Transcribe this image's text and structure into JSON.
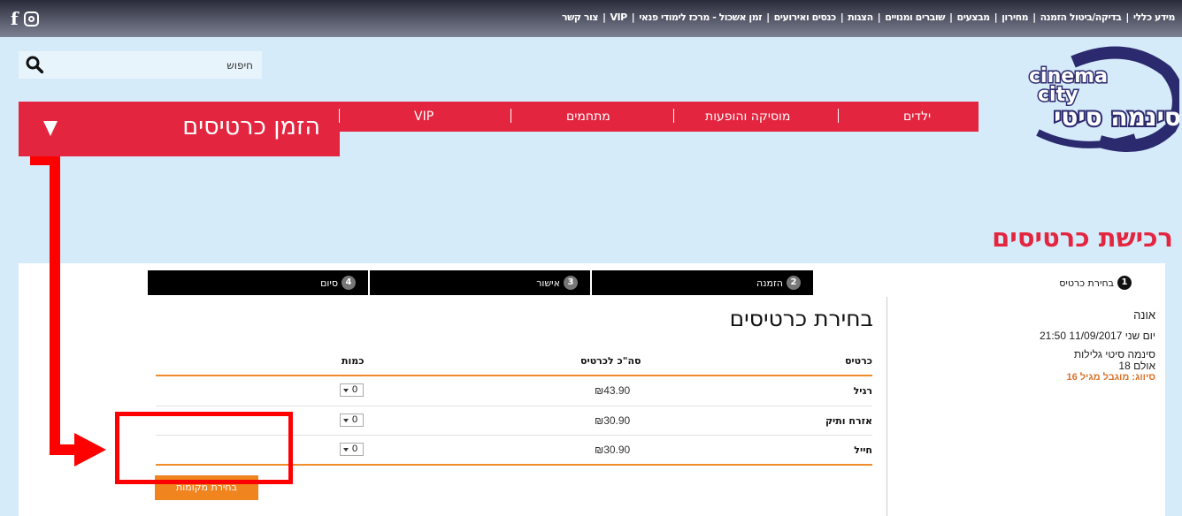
{
  "top_nav": {
    "links": [
      "מידע כללי",
      "בדיקה/ביטול הזמנה",
      "מחירון",
      "מבצעים",
      "שוברים ומנויים",
      "הצגות",
      "כנסים ואירועים",
      "זמן אשכול - מרכז לימודי פנאי",
      "VIP",
      "צור קשר"
    ]
  },
  "search": {
    "placeholder": "חיפוש"
  },
  "logo": {
    "line1": "cinema",
    "line2": "city",
    "hebrew": "סינמה סיטי"
  },
  "main_nav": {
    "items": [
      "ילדים",
      "מוסיקה והופעות",
      "מתחמים",
      "VIP"
    ],
    "order_label": "הזמן כרטיסים"
  },
  "page": {
    "title": "רכישת כרטיסים"
  },
  "steps": [
    {
      "num": "1",
      "label": "בחירת כרטיס"
    },
    {
      "num": "2",
      "label": "הזמנה"
    },
    {
      "num": "3",
      "label": "אישור"
    },
    {
      "num": "4",
      "label": "סיום"
    }
  ],
  "movie": {
    "title": "אונה",
    "datetime": "יום שני 11/09/2017 21:50",
    "cinema": "סינמה סיטי גלילות",
    "hall": "אולם 18",
    "rating": "סיווג: מוגבל מגיל 16"
  },
  "tickets": {
    "section_title": "בחירת כרטיסים",
    "headers": {
      "type": "כרטיס",
      "price": "סה\"כ לכרטיס",
      "qty": "כמות"
    },
    "rows": [
      {
        "type": "רגיל",
        "price": "₪43.90",
        "qty": "0"
      },
      {
        "type": "אזרח ותיק",
        "price": "₪30.90",
        "qty": "0"
      },
      {
        "type": "חייל",
        "price": "₪30.90",
        "qty": "0"
      }
    ],
    "submit_label": "בחירת מקומות"
  },
  "colors": {
    "brand_red": "#e4253f",
    "accent_orange": "#f0841f",
    "annotation_red": "#ff0000"
  }
}
